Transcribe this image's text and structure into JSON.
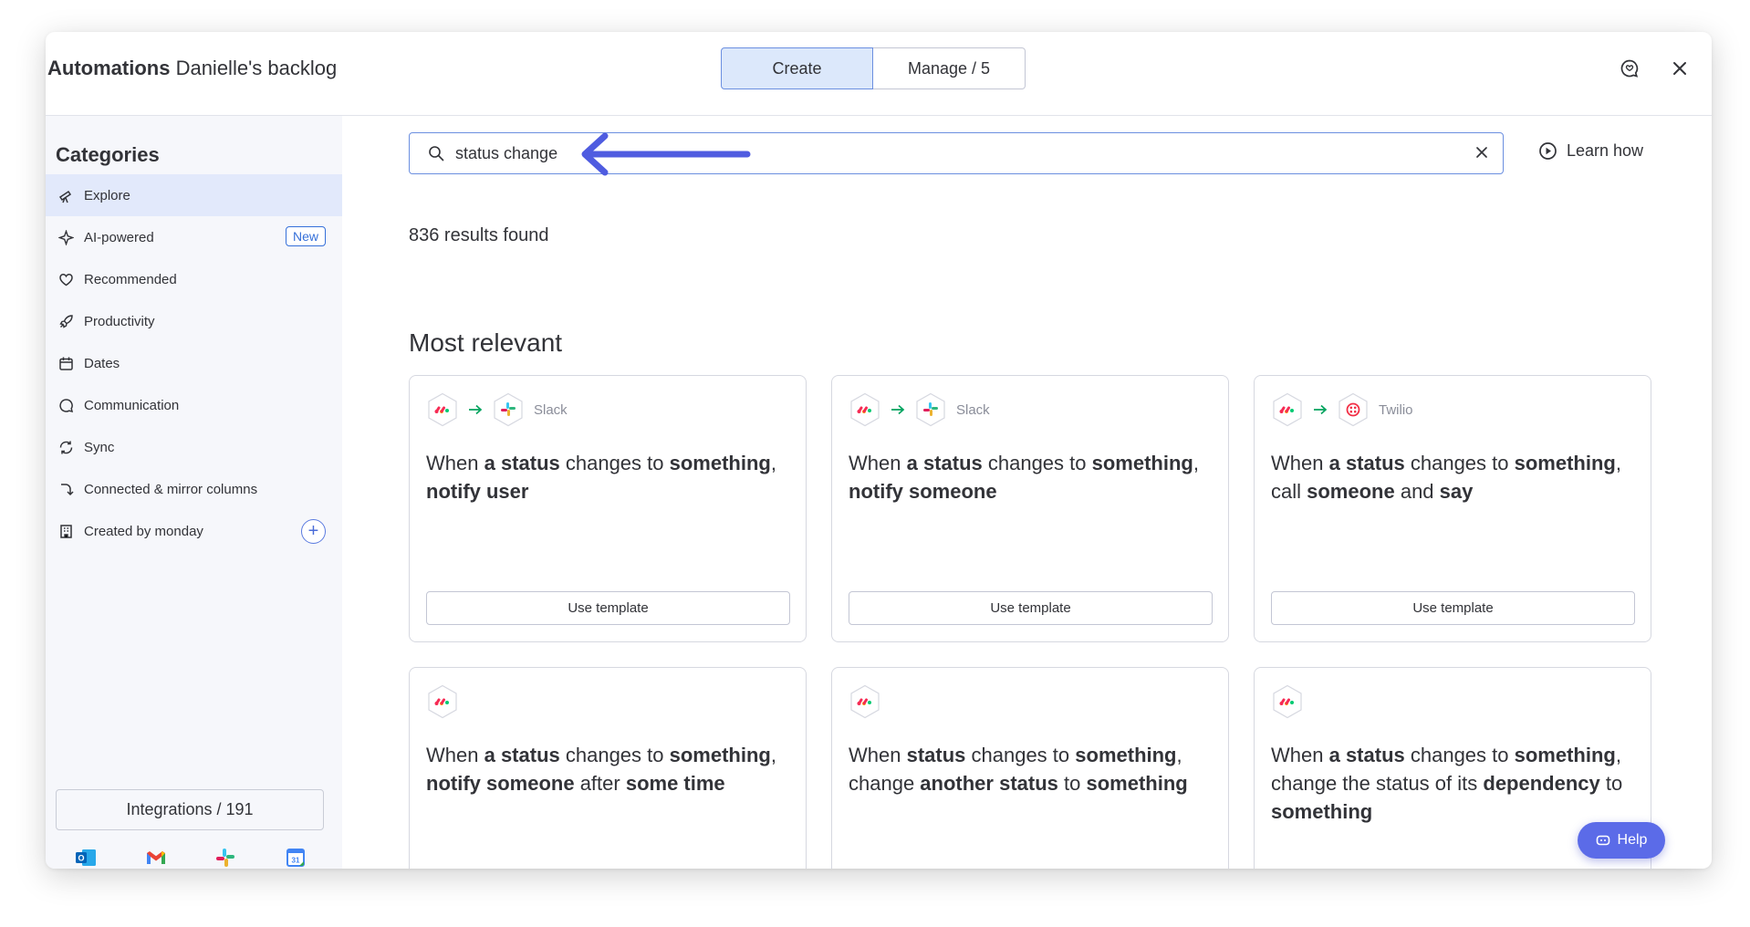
{
  "header": {
    "title_bold": "Automations",
    "title_rest": "Danielle's backlog",
    "tabs": [
      {
        "label": "Create",
        "active": true
      },
      {
        "label": "Manage / 5",
        "active": false
      }
    ]
  },
  "sidebar": {
    "title": "Categories",
    "items": [
      {
        "label": "Explore",
        "icon": "telescope-icon",
        "active": true
      },
      {
        "label": "AI-powered",
        "icon": "sparkle-icon",
        "badge": "New"
      },
      {
        "label": "Recommended",
        "icon": "heart-icon"
      },
      {
        "label": "Productivity",
        "icon": "rocket-icon"
      },
      {
        "label": "Dates",
        "icon": "calendar-icon"
      },
      {
        "label": "Communication",
        "icon": "chat-bubble-icon"
      },
      {
        "label": "Sync",
        "icon": "sync-icon"
      },
      {
        "label": "Connected & mirror columns",
        "icon": "connect-icon"
      },
      {
        "label": "Created by monday",
        "icon": "building-icon"
      }
    ],
    "integrations_label": "Integrations / 191",
    "integration_icons": [
      "outlook-icon",
      "gmail-icon",
      "slack-icon",
      "google-calendar-icon"
    ]
  },
  "search": {
    "value": "status change",
    "learn_label": "Learn how"
  },
  "results_text": "836 results found",
  "section_title": "Most relevant",
  "cards": [
    {
      "app": "Slack",
      "text_html": "When <b>a status</b> changes to <b>something</b>, <b>notify user</b>",
      "button": "Use template"
    },
    {
      "app": "Slack",
      "text_html": "When <b>a status</b> changes to <b>something</b>, <b>notify someone</b>",
      "button": "Use template"
    },
    {
      "app": "Twilio",
      "text_html": "When <b>a status</b> changes to <b>something</b>, call <b>someone</b> and <b>say</b>",
      "button": "Use template"
    },
    {
      "app": "",
      "text_html": "When <b>a status</b> changes to <b>something</b>, <b>notify someone</b> after <b>some time</b>",
      "button": ""
    },
    {
      "app": "",
      "text_html": "When <b>status</b> changes to <b>something</b>, change <b>another status</b> to <b>something</b>",
      "button": ""
    },
    {
      "app": "",
      "text_html": "When <b>a status</b> changes to <b>something</b>, change the status of its <b>dependency</b> to <b>something</b>",
      "button": ""
    }
  ],
  "help_label": "Help",
  "colors": {
    "accent": "#5b6be8",
    "selected_bg": "#dce8fb",
    "sidebar_bg": "#f6f7fb",
    "annotation_arrow": "#4f5ce0"
  }
}
